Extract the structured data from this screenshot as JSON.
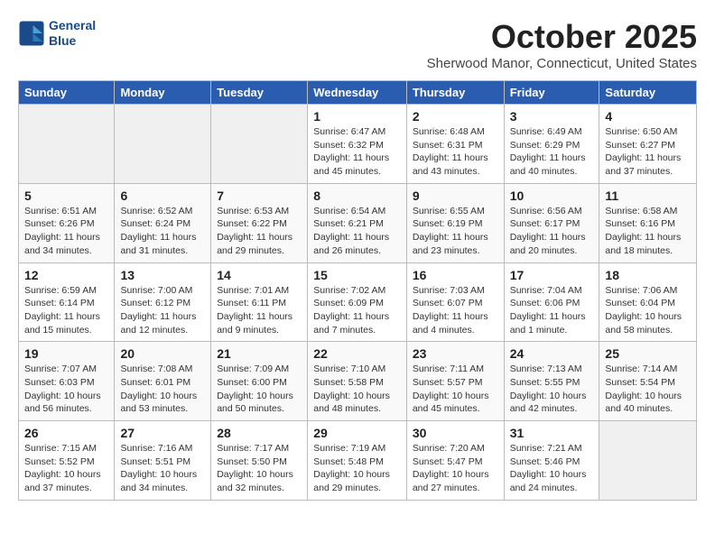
{
  "header": {
    "logo_line1": "General",
    "logo_line2": "Blue",
    "month": "October 2025",
    "location": "Sherwood Manor, Connecticut, United States"
  },
  "days_of_week": [
    "Sunday",
    "Monday",
    "Tuesday",
    "Wednesday",
    "Thursday",
    "Friday",
    "Saturday"
  ],
  "weeks": [
    [
      {
        "day": "",
        "info": ""
      },
      {
        "day": "",
        "info": ""
      },
      {
        "day": "",
        "info": ""
      },
      {
        "day": "1",
        "info": "Sunrise: 6:47 AM\nSunset: 6:32 PM\nDaylight: 11 hours and 45 minutes."
      },
      {
        "day": "2",
        "info": "Sunrise: 6:48 AM\nSunset: 6:31 PM\nDaylight: 11 hours and 43 minutes."
      },
      {
        "day": "3",
        "info": "Sunrise: 6:49 AM\nSunset: 6:29 PM\nDaylight: 11 hours and 40 minutes."
      },
      {
        "day": "4",
        "info": "Sunrise: 6:50 AM\nSunset: 6:27 PM\nDaylight: 11 hours and 37 minutes."
      }
    ],
    [
      {
        "day": "5",
        "info": "Sunrise: 6:51 AM\nSunset: 6:26 PM\nDaylight: 11 hours and 34 minutes."
      },
      {
        "day": "6",
        "info": "Sunrise: 6:52 AM\nSunset: 6:24 PM\nDaylight: 11 hours and 31 minutes."
      },
      {
        "day": "7",
        "info": "Sunrise: 6:53 AM\nSunset: 6:22 PM\nDaylight: 11 hours and 29 minutes."
      },
      {
        "day": "8",
        "info": "Sunrise: 6:54 AM\nSunset: 6:21 PM\nDaylight: 11 hours and 26 minutes."
      },
      {
        "day": "9",
        "info": "Sunrise: 6:55 AM\nSunset: 6:19 PM\nDaylight: 11 hours and 23 minutes."
      },
      {
        "day": "10",
        "info": "Sunrise: 6:56 AM\nSunset: 6:17 PM\nDaylight: 11 hours and 20 minutes."
      },
      {
        "day": "11",
        "info": "Sunrise: 6:58 AM\nSunset: 6:16 PM\nDaylight: 11 hours and 18 minutes."
      }
    ],
    [
      {
        "day": "12",
        "info": "Sunrise: 6:59 AM\nSunset: 6:14 PM\nDaylight: 11 hours and 15 minutes."
      },
      {
        "day": "13",
        "info": "Sunrise: 7:00 AM\nSunset: 6:12 PM\nDaylight: 11 hours and 12 minutes."
      },
      {
        "day": "14",
        "info": "Sunrise: 7:01 AM\nSunset: 6:11 PM\nDaylight: 11 hours and 9 minutes."
      },
      {
        "day": "15",
        "info": "Sunrise: 7:02 AM\nSunset: 6:09 PM\nDaylight: 11 hours and 7 minutes."
      },
      {
        "day": "16",
        "info": "Sunrise: 7:03 AM\nSunset: 6:07 PM\nDaylight: 11 hours and 4 minutes."
      },
      {
        "day": "17",
        "info": "Sunrise: 7:04 AM\nSunset: 6:06 PM\nDaylight: 11 hours and 1 minute."
      },
      {
        "day": "18",
        "info": "Sunrise: 7:06 AM\nSunset: 6:04 PM\nDaylight: 10 hours and 58 minutes."
      }
    ],
    [
      {
        "day": "19",
        "info": "Sunrise: 7:07 AM\nSunset: 6:03 PM\nDaylight: 10 hours and 56 minutes."
      },
      {
        "day": "20",
        "info": "Sunrise: 7:08 AM\nSunset: 6:01 PM\nDaylight: 10 hours and 53 minutes."
      },
      {
        "day": "21",
        "info": "Sunrise: 7:09 AM\nSunset: 6:00 PM\nDaylight: 10 hours and 50 minutes."
      },
      {
        "day": "22",
        "info": "Sunrise: 7:10 AM\nSunset: 5:58 PM\nDaylight: 10 hours and 48 minutes."
      },
      {
        "day": "23",
        "info": "Sunrise: 7:11 AM\nSunset: 5:57 PM\nDaylight: 10 hours and 45 minutes."
      },
      {
        "day": "24",
        "info": "Sunrise: 7:13 AM\nSunset: 5:55 PM\nDaylight: 10 hours and 42 minutes."
      },
      {
        "day": "25",
        "info": "Sunrise: 7:14 AM\nSunset: 5:54 PM\nDaylight: 10 hours and 40 minutes."
      }
    ],
    [
      {
        "day": "26",
        "info": "Sunrise: 7:15 AM\nSunset: 5:52 PM\nDaylight: 10 hours and 37 minutes."
      },
      {
        "day": "27",
        "info": "Sunrise: 7:16 AM\nSunset: 5:51 PM\nDaylight: 10 hours and 34 minutes."
      },
      {
        "day": "28",
        "info": "Sunrise: 7:17 AM\nSunset: 5:50 PM\nDaylight: 10 hours and 32 minutes."
      },
      {
        "day": "29",
        "info": "Sunrise: 7:19 AM\nSunset: 5:48 PM\nDaylight: 10 hours and 29 minutes."
      },
      {
        "day": "30",
        "info": "Sunrise: 7:20 AM\nSunset: 5:47 PM\nDaylight: 10 hours and 27 minutes."
      },
      {
        "day": "31",
        "info": "Sunrise: 7:21 AM\nSunset: 5:46 PM\nDaylight: 10 hours and 24 minutes."
      },
      {
        "day": "",
        "info": ""
      }
    ]
  ]
}
